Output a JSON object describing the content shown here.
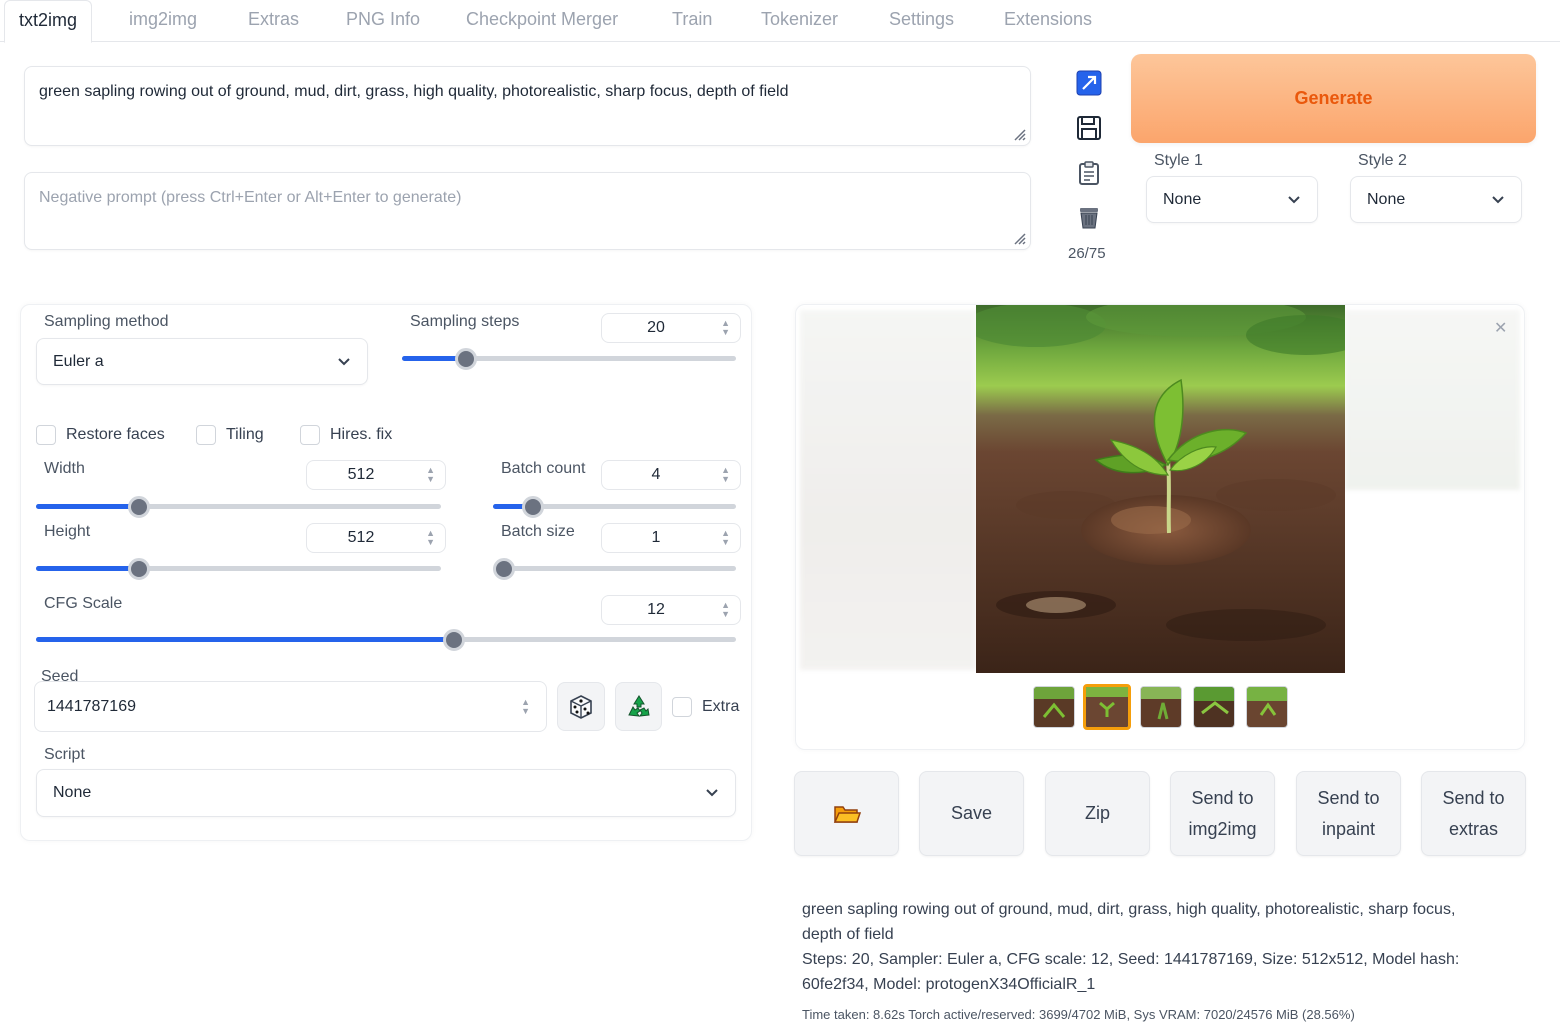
{
  "tabs": [
    {
      "label": "txt2img",
      "active": true
    },
    {
      "label": "img2img"
    },
    {
      "label": "Extras"
    },
    {
      "label": "PNG Info"
    },
    {
      "label": "Checkpoint Merger"
    },
    {
      "label": "Train"
    },
    {
      "label": "Tokenizer"
    },
    {
      "label": "Settings"
    },
    {
      "label": "Extensions"
    }
  ],
  "prompt": {
    "value": "green sapling rowing out of ground, mud, dirt, grass, high quality, photorealistic, sharp focus, depth of field",
    "negative_placeholder": "Negative prompt (press Ctrl+Enter or Alt+Enter to generate)",
    "token_count": "26/75"
  },
  "generate_label": "Generate",
  "styles": {
    "style1": {
      "label": "Style 1",
      "value": "None"
    },
    "style2": {
      "label": "Style 2",
      "value": "None"
    }
  },
  "settings": {
    "sampling_method": {
      "label": "Sampling method",
      "value": "Euler a"
    },
    "sampling_steps": {
      "label": "Sampling steps",
      "value": "20",
      "fraction": 0.17
    },
    "restore_faces": "Restore faces",
    "tiling": "Tiling",
    "hires_fix": "Hires. fix",
    "width": {
      "label": "Width",
      "value": "512",
      "fraction": 0.24
    },
    "height": {
      "label": "Height",
      "value": "512",
      "fraction": 0.24
    },
    "batch_count": {
      "label": "Batch count",
      "value": "4",
      "fraction": 0.13
    },
    "batch_size": {
      "label": "Batch size",
      "value": "1",
      "fraction": 0.0
    },
    "cfg_scale": {
      "label": "CFG Scale",
      "value": "12",
      "fraction": 0.6
    },
    "seed": {
      "label": "Seed",
      "value": "1441787169"
    },
    "extra": "Extra",
    "script": {
      "label": "Script",
      "value": "None"
    }
  },
  "actions": {
    "save": "Save",
    "zip": "Zip",
    "send_img2img": [
      "Send to",
      "img2img"
    ],
    "send_inpaint": [
      "Send to",
      "inpaint"
    ],
    "send_extras": [
      "Send to",
      "extras"
    ]
  },
  "output_info": {
    "line1": "green sapling rowing out of ground, mud, dirt, grass, high quality, photorealistic, sharp focus,",
    "line2": "depth of field",
    "line3": "Steps: 20, Sampler: Euler a, CFG scale: 12, Seed: 1441787169, Size: 512x512, Model hash:",
    "line4": "60fe2f34, Model: protogenX34OfficialR_1",
    "line5": "Time taken: 8.62s  Torch active/reserved: 3699/4702 MiB, Sys VRAM: 7020/24576 MiB (28.56%)"
  },
  "colors": {
    "accent": "#2563eb",
    "generate_text": "#ea580c"
  }
}
